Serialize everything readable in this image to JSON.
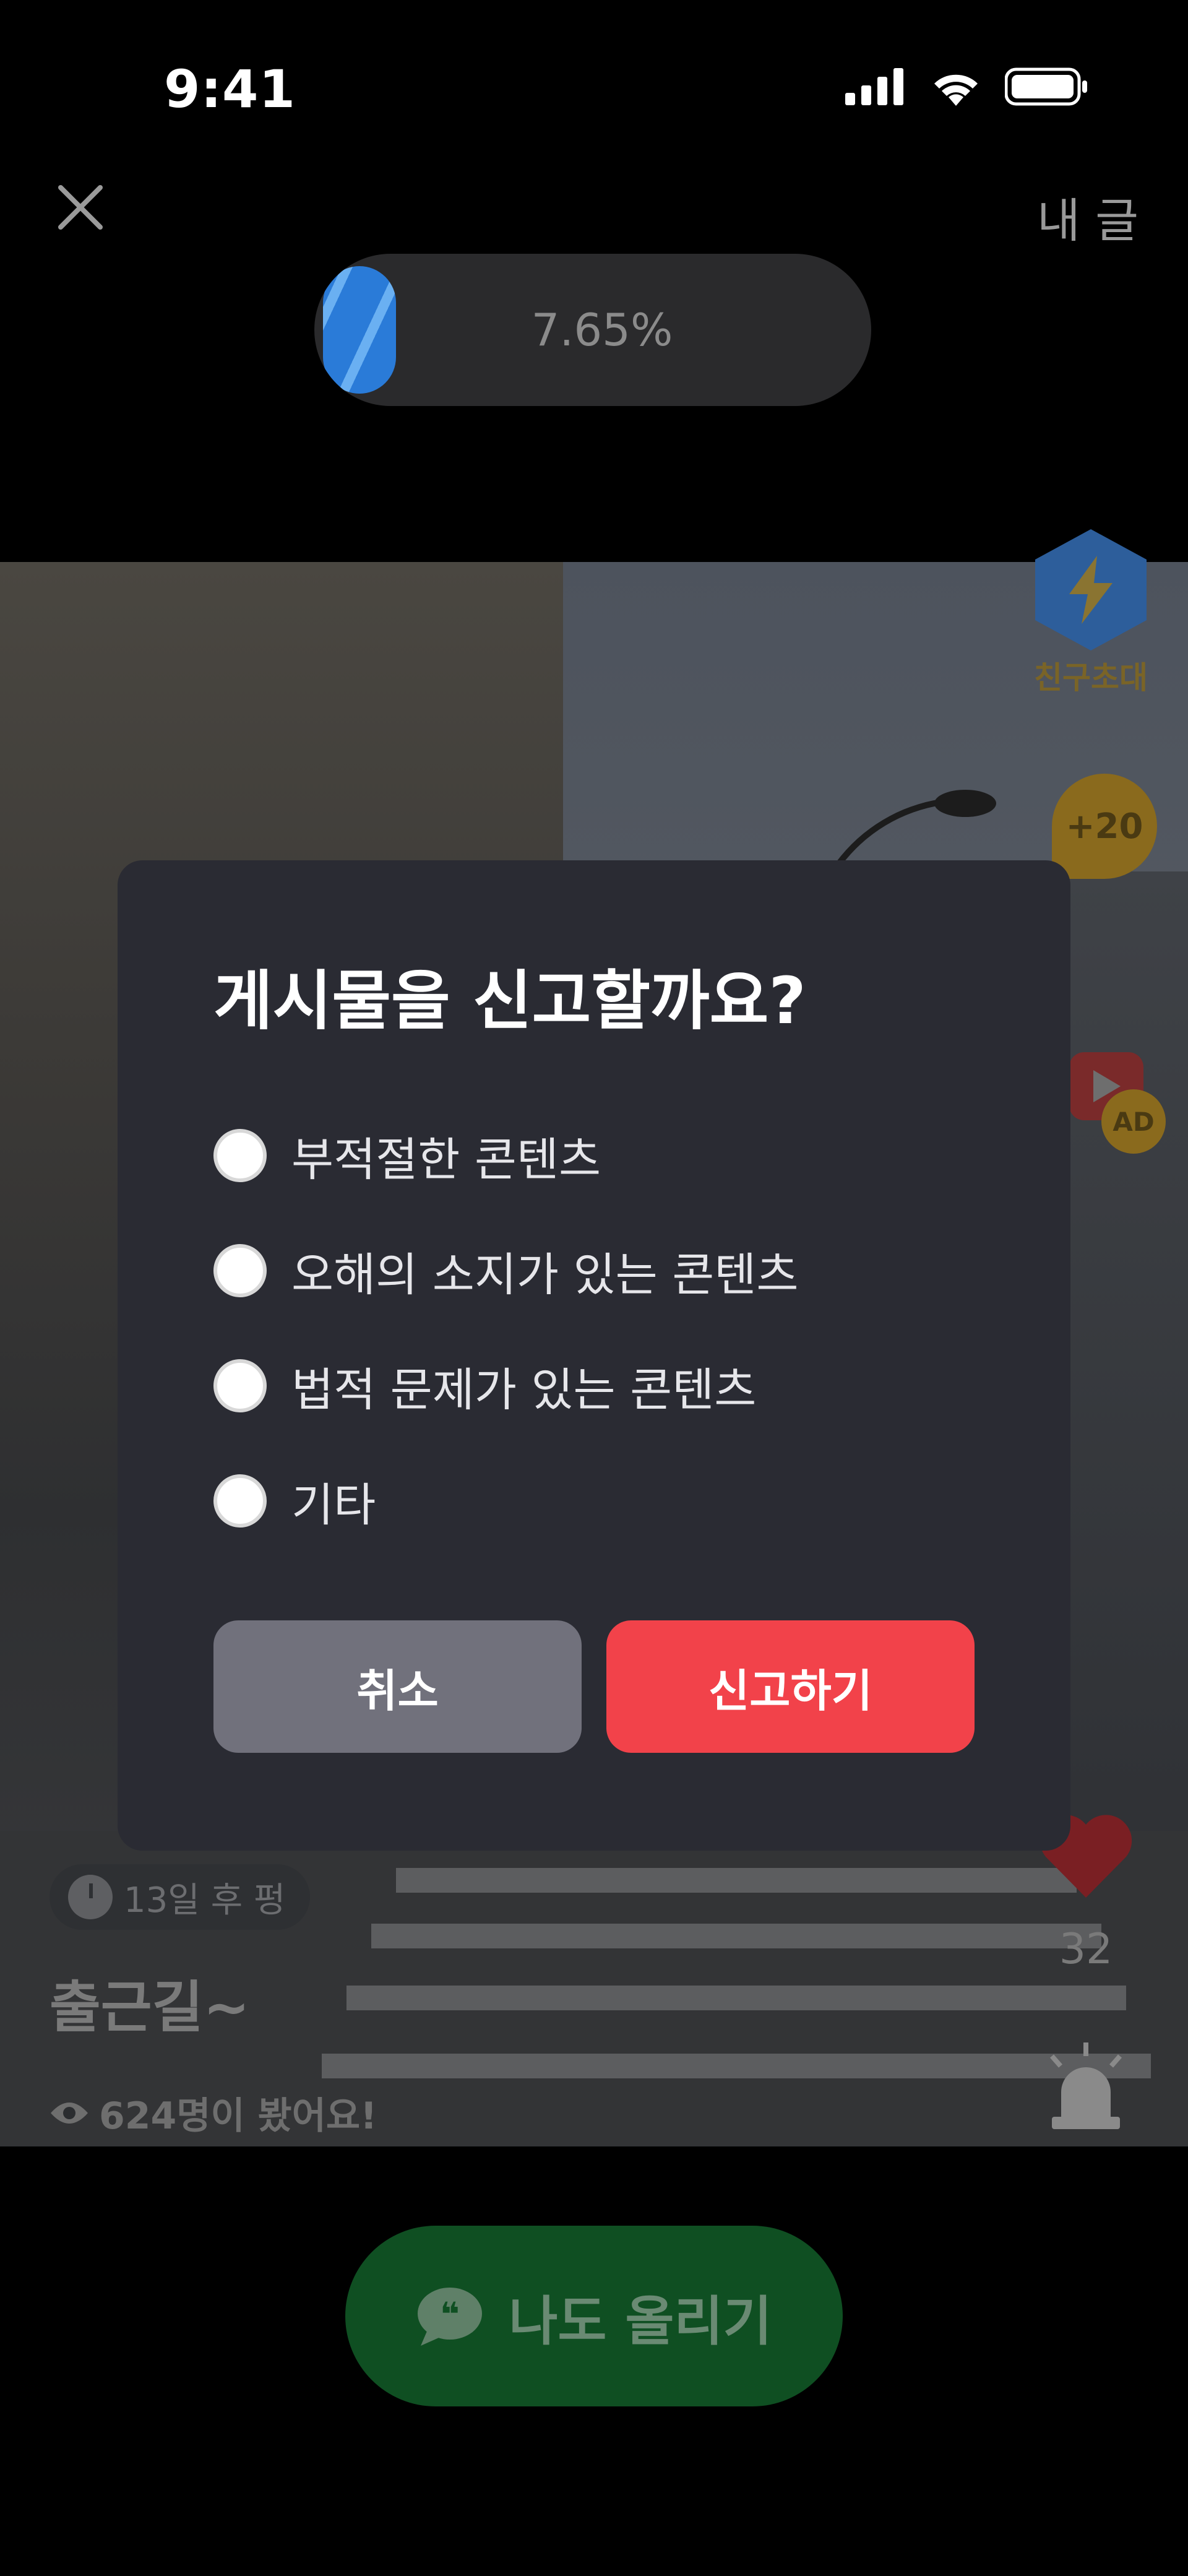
{
  "status_bar": {
    "time": "9:41"
  },
  "header": {
    "my_post_label": "내 글",
    "progress_text": "7.65%",
    "progress_value": 0.0765
  },
  "side_actions": {
    "invite_label": "친구초대",
    "bonus_badge": "+20",
    "ad_badge": "AD"
  },
  "post": {
    "days_chip": "13일 후 펑",
    "title": "출근길~",
    "views": "624명이 봤어요!",
    "like_count": "32"
  },
  "cta": {
    "label": "나도 올리기"
  },
  "report_modal": {
    "title": "게시물을 신고할까요?",
    "options": [
      {
        "label": "부적절한 콘텐츠"
      },
      {
        "label": "오해의 소지가 있는 콘텐츠"
      },
      {
        "label": "법적 문제가 있는 콘텐츠"
      },
      {
        "label": "기타"
      }
    ],
    "cancel_label": "취소",
    "confirm_label": "신고하기"
  },
  "colors": {
    "modal_bg": "#2a2b33",
    "confirm": "#f2424a",
    "cancel": "#71717c",
    "cta": "#0f4f22"
  }
}
